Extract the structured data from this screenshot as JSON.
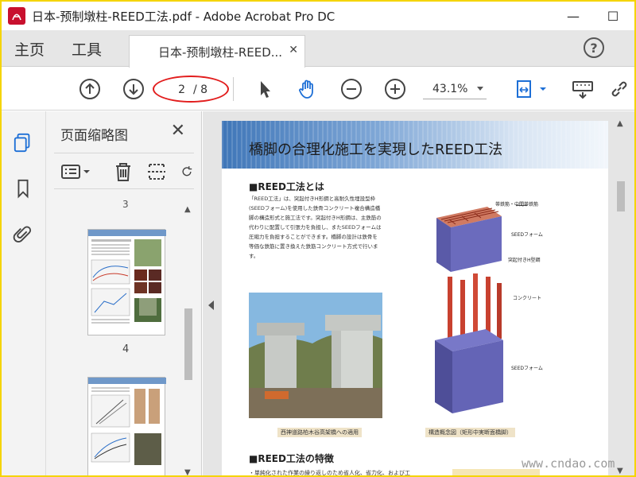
{
  "window": {
    "title": "日本-预制墩柱-REED工法.pdf - Adobe Acrobat Pro DC",
    "minimize_glyph": "—",
    "maximize_glyph": "☐"
  },
  "tabs": {
    "home": "主页",
    "tools": "工具",
    "document": "日本-预制墩柱-REED...",
    "close_glyph": "✕",
    "help_glyph": "?"
  },
  "toolbar": {
    "current_page": "2",
    "total_pages": "/ 8",
    "zoom": "43.1%",
    "highlight_color": "#e21d1d"
  },
  "thumbnails": {
    "title": "页面缩略图",
    "close_glyph": "✕",
    "partial_page_number": "3",
    "pages": [
      {
        "number": "4"
      }
    ]
  },
  "document_page": {
    "title": "橋脚の合理化施工を実現したREED工法",
    "section1_heading": "■REED工法とは",
    "section1_body": "「REED工法」は、突起付きH形鋼と高耐久性埋設型枠(SEEDフォーム)を使用した鉄骨コンクリート複合構造橋脚の構造形式と施工法です。突起付きH形鋼は、主鉄筋の代わりに配置して引張力を負担し、またSEEDフォームは圧縮力を負担することができます。橋脚の設計は鉄骨を等価な鉄筋に置き換えた鉄筋コンクリート方式で行います。",
    "photo_caption": "西神道路柏木谷高架橋への適用",
    "diagram_caption": "構造概念図（矩形中実断面橋脚）",
    "diagram_labels": {
      "rebar": "帯鉄筋・中間帯鉄筋",
      "form_top": "SEEDフォーム",
      "h_steel": "突起付きH型鋼",
      "concrete": "コンクリート",
      "form_bottom": "SEEDフォーム"
    },
    "section2_heading": "■REED工法の特徴",
    "section2_bullet": "・単純化された作業の繰り返しのため省人化、省力化、および工"
  },
  "watermark": "www.cndao.com"
}
